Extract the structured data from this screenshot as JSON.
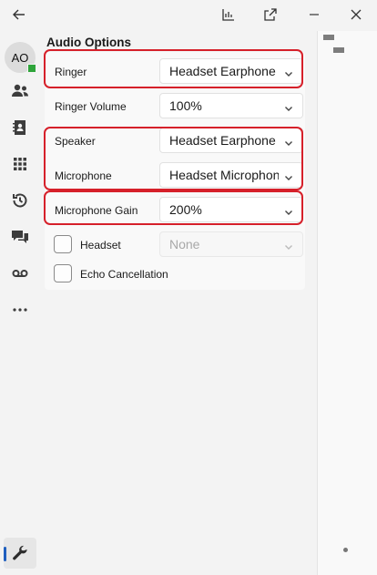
{
  "avatar": {
    "initials": "AO"
  },
  "panel": {
    "title": "Audio Options"
  },
  "settings": {
    "ringer": {
      "label": "Ringer",
      "value": "Headset Earphone"
    },
    "ringer_volume": {
      "label": "Ringer Volume",
      "value": "100%"
    },
    "speaker": {
      "label": "Speaker",
      "value": "Headset Earphone"
    },
    "microphone": {
      "label": "Microphone",
      "value": "Headset Microphone"
    },
    "microphone_gain": {
      "label": "Microphone Gain",
      "value": "200%"
    },
    "headset": {
      "label": "Headset",
      "value": "None",
      "checked": false
    },
    "echo_cancellation": {
      "label": "Echo Cancellation",
      "checked": false
    }
  },
  "colors": {
    "highlight": "#d6202a",
    "presence": "#2ea43a",
    "active": "#1f5fbf"
  }
}
